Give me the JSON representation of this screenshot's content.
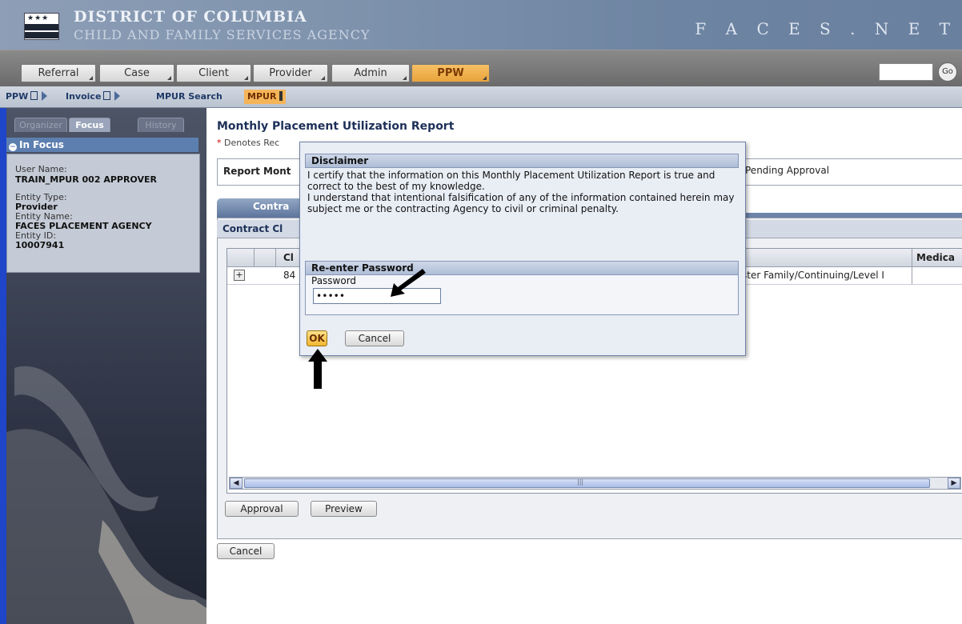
{
  "header": {
    "flag_stars": "★★★",
    "agency_line1": "DISTRICT OF COLUMBIA",
    "agency_line2": "CHILD AND FAMILY SERVICES AGENCY",
    "system_name": "F A C E S . N E T"
  },
  "menu": {
    "tabs": [
      {
        "label": "Referral"
      },
      {
        "label": "Case"
      },
      {
        "label": "Client"
      },
      {
        "label": "Provider"
      },
      {
        "label": "Admin"
      },
      {
        "label": "PPW",
        "active": true
      }
    ],
    "search_value": "",
    "go_label": "Go"
  },
  "breadcrumb": {
    "items": [
      "PPW",
      "Invoice",
      "MPUR Search",
      "MPUR"
    ]
  },
  "sidebar": {
    "tabs": [
      "Organizer",
      "Focus",
      "History"
    ],
    "active_tab": "Focus",
    "section_title": "In Focus",
    "user_name_label": "User Name:",
    "user_name": "TRAIN_MPUR 002 APPROVER",
    "entity_type_label": "Entity Type:",
    "entity_type": "Provider",
    "entity_name_label": "Entity Name:",
    "entity_name": "FACES PLACEMENT AGENCY",
    "entity_id_label": "Entity ID:",
    "entity_id": "10007941"
  },
  "main": {
    "title": "Monthly Placement Utilization Report",
    "required_star": "*",
    "required_note": "Denotes Rec",
    "report_month_label": "Report Mont",
    "status_value": "Pending Approval",
    "tab_label": "Contra",
    "contract_section_label": "Contract Cl",
    "grid": {
      "col_client_header": "Cl",
      "col_medical_header": "Medica",
      "row_client_value": "84",
      "row_service_value": "ster Family/Continuing/Level I",
      "expand_symbol": "+"
    },
    "scroll_thumb_grip": "|||",
    "approval_button": "Approval",
    "preview_button": "Preview",
    "cancel_button": "Cancel"
  },
  "dialog": {
    "disclaimer_title": "Disclaimer",
    "disclaimer_text_1": "I certify that the information on this Monthly Placement Utilization Report is true and correct to the best of my knowledge.",
    "disclaimer_text_2": "I understand that intentional falsification of any of the information contained herein may subject me or the contracting Agency to civil or criminal penalty.",
    "password_section_title": "Re-enter Password",
    "password_label": "Password",
    "password_value": "•••••",
    "ok_label": "OK",
    "cancel_label": "Cancel"
  },
  "colors": {
    "accent_orange": "#f4b558",
    "banner_blue": "#7f93ad",
    "sidebar_edge": "#1f45c9"
  }
}
